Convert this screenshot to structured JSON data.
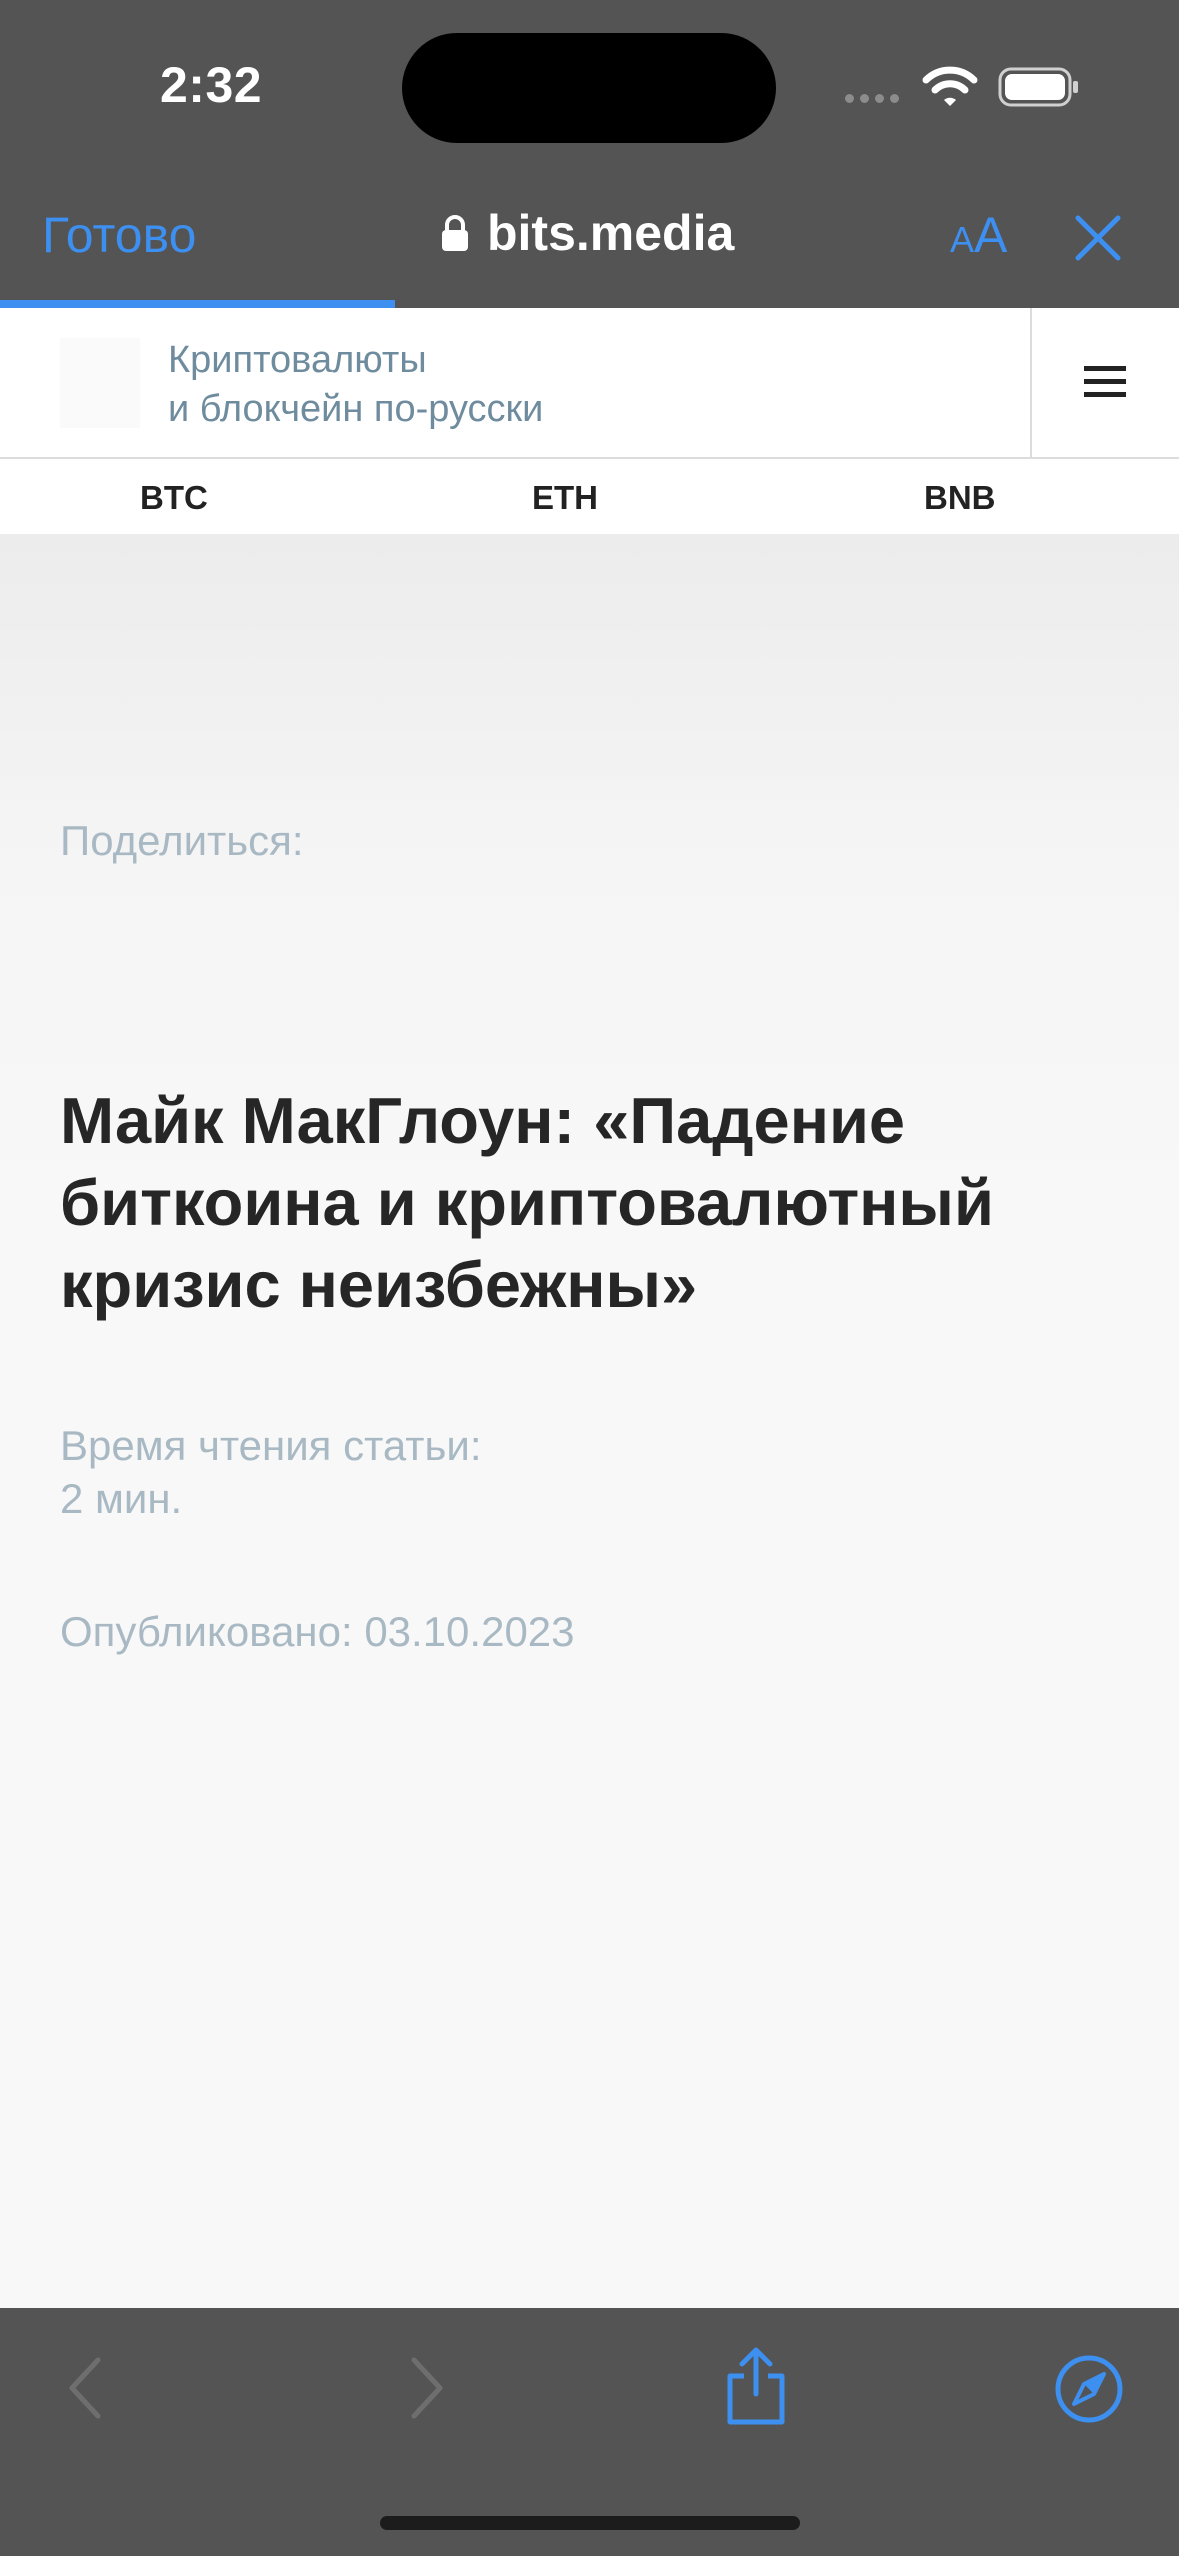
{
  "status_bar": {
    "time": "2:32"
  },
  "browser": {
    "done_label": "Готово",
    "url": "bits.media",
    "text_size_small": "A",
    "text_size_large": "A"
  },
  "site": {
    "tagline_line1": "Криптовалюты",
    "tagline_line2": "и блокчейн по-русски"
  },
  "ticker": {
    "items": [
      "BTC",
      "ETH",
      "BNB"
    ]
  },
  "article": {
    "share_label": "Поделиться:",
    "title": "Майк МакГлоун: «Падение биткоина и криптовалютный кризис неизбежны»",
    "read_time_label": "Время чтения статьи:",
    "read_time_value": "2 мин.",
    "published": "Опубликовано: 03.10.2023"
  },
  "colors": {
    "chrome_bg": "#545454",
    "accent_blue": "#3d8ff0",
    "meta_text": "#a9b9c4",
    "tagline_text": "#6f8c9f",
    "title_text": "#262626"
  },
  "icons": {
    "lock": "lock-icon",
    "close": "close-icon",
    "menu": "hamburger-menu-icon",
    "back": "chevron-left-icon",
    "forward": "chevron-right-icon",
    "share": "share-icon",
    "safari": "compass-icon"
  }
}
